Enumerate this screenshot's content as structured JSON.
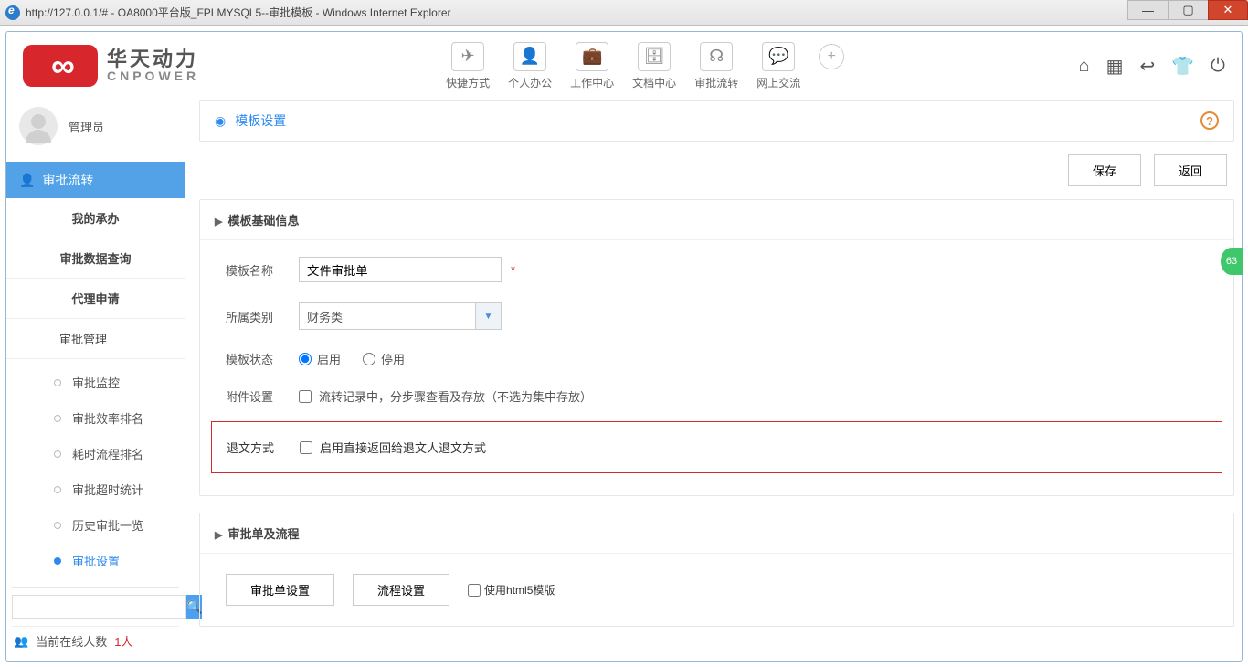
{
  "window": {
    "url": "http://127.0.0.1/# - OA8000平台版_FPLMYSQL5--审批模板 - Windows Internet Explorer"
  },
  "logo": {
    "zh": "华天动力",
    "en": "CNPOWER"
  },
  "topnav": [
    {
      "label": "快捷方式",
      "glyph": "✈"
    },
    {
      "label": "个人办公",
      "glyph": "👤"
    },
    {
      "label": "工作中心",
      "glyph": "💼"
    },
    {
      "label": "文档中心",
      "glyph": "🗄"
    },
    {
      "label": "审批流转",
      "glyph": "☊"
    },
    {
      "label": "网上交流",
      "glyph": "💬"
    }
  ],
  "user": {
    "name": "管理员"
  },
  "sidebar": {
    "group": "审批流转",
    "items": [
      "我的承办",
      "审批数据查询",
      "代理申请",
      "审批管理"
    ],
    "subitems": [
      "审批监控",
      "审批效率排名",
      "耗时流程排名",
      "审批超时统计",
      "历史审批一览",
      "审批设置"
    ]
  },
  "online": {
    "label": "当前在线人数",
    "count": "1人"
  },
  "page": {
    "title": "模板设置",
    "buttons": {
      "save": "保存",
      "back": "返回"
    }
  },
  "panel1": {
    "title": "模板基础信息",
    "fields": {
      "name_label": "模板名称",
      "name_value": "文件审批单",
      "cat_label": "所属类别",
      "cat_value": "财务类",
      "status_label": "模板状态",
      "status_enable": "启用",
      "status_disable": "停用",
      "attach_label": "附件设置",
      "attach_text": "流转记录中，分步骤查看及存放（不选为集中存放）",
      "return_label": "退文方式",
      "return_text": "启用直接返回给退文人退文方式"
    }
  },
  "panel2": {
    "title": "审批单及流程",
    "btn1": "审批单设置",
    "btn2": "流程设置",
    "cb": "使用html5模版"
  },
  "badge": "63"
}
